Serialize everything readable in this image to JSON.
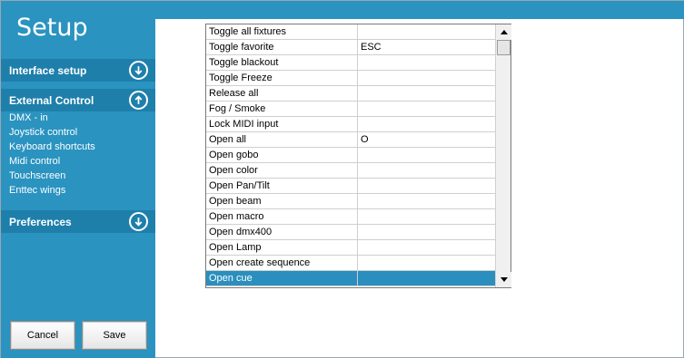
{
  "sidebar": {
    "title": "Setup",
    "sections": [
      {
        "label": "Interface setup",
        "icon": "chevron-down-icon"
      },
      {
        "label": "External Control",
        "icon": "chevron-up-icon"
      },
      {
        "label": "Preferences",
        "icon": "chevron-down-icon"
      }
    ],
    "external_control_items": [
      "DMX - in",
      "Joystick control",
      "Keyboard shortcuts",
      "Midi control",
      "Touchscreen",
      "Enttec wings"
    ],
    "cancel_label": "Cancel",
    "save_label": "Save"
  },
  "table": {
    "rows": [
      {
        "action": "Toggle all fixtures",
        "shortcut": ""
      },
      {
        "action": "Toggle favorite",
        "shortcut": "ESC"
      },
      {
        "action": "Toggle blackout",
        "shortcut": ""
      },
      {
        "action": "Toggle Freeze",
        "shortcut": ""
      },
      {
        "action": "Release all",
        "shortcut": ""
      },
      {
        "action": "Fog / Smoke",
        "shortcut": ""
      },
      {
        "action": "Lock MIDI input",
        "shortcut": ""
      },
      {
        "action": "Open all",
        "shortcut": "O"
      },
      {
        "action": "Open gobo",
        "shortcut": ""
      },
      {
        "action": "Open color",
        "shortcut": ""
      },
      {
        "action": "Open Pan/Tilt",
        "shortcut": ""
      },
      {
        "action": "Open beam",
        "shortcut": ""
      },
      {
        "action": "Open macro",
        "shortcut": ""
      },
      {
        "action": "Open dmx400",
        "shortcut": ""
      },
      {
        "action": "Open Lamp",
        "shortcut": ""
      },
      {
        "action": "Open create sequence",
        "shortcut": ""
      },
      {
        "action": "Open cue",
        "shortcut": ""
      }
    ],
    "selected_row": "Open cue"
  },
  "colors": {
    "accent": "#2a93c0",
    "section_header": "#1e7fab",
    "selection": "#2a8fbe"
  }
}
